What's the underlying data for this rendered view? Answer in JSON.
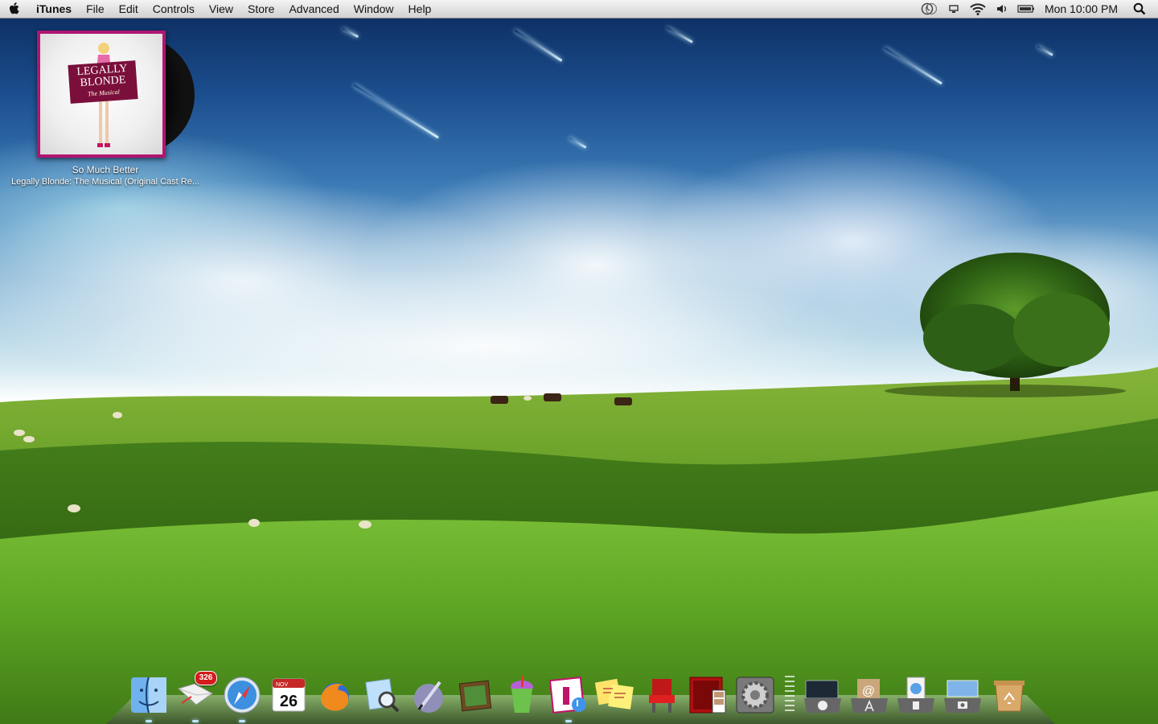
{
  "menubar": {
    "apple_icon": "apple-icon",
    "app_name": "iTunes",
    "menus": [
      "File",
      "Edit",
      "Controls",
      "View",
      "Store",
      "Advanced",
      "Window",
      "Help"
    ],
    "status_icons": [
      "time-machine-icon",
      "display-icon",
      "wifi-icon",
      "volume-icon",
      "battery-icon"
    ],
    "clock": "Mon 10:00 PM",
    "spotlight_icon": "spotlight-search-icon"
  },
  "now_playing": {
    "song": "So Much Better",
    "album": "Legally Blonde: The Musical (Original Cast Re...",
    "art_title_line1": "LEGALLY",
    "art_title_line2": "BLONDE",
    "art_subtitle": "The Musical"
  },
  "dock": {
    "apps": [
      {
        "name": "Finder",
        "icon": "finder-icon",
        "running": true
      },
      {
        "name": "Mail",
        "icon": "mail-icon",
        "badge": "326",
        "running": true
      },
      {
        "name": "Safari",
        "icon": "safari-icon",
        "running": true
      },
      {
        "name": "iCal",
        "icon": "calendar-icon",
        "month": "NOV",
        "day": "26"
      },
      {
        "name": "Firefox",
        "icon": "firefox-icon"
      },
      {
        "name": "Preview",
        "icon": "preview-icon"
      },
      {
        "name": "Script Editor",
        "icon": "script-editor-icon"
      },
      {
        "name": "iPhoto",
        "icon": "photo-frame-icon"
      },
      {
        "name": "Slurpee",
        "icon": "slurpee-cup-icon"
      },
      {
        "name": "iTunes",
        "icon": "itunes-icon",
        "running": true
      },
      {
        "name": "Stickies",
        "icon": "stickies-icon"
      },
      {
        "name": "Front Row",
        "icon": "front-row-chair-icon"
      },
      {
        "name": "Photo Booth",
        "icon": "photo-booth-icon"
      },
      {
        "name": "System Preferences",
        "icon": "system-preferences-icon"
      }
    ],
    "stacks": [
      {
        "name": "Applications",
        "icon": "applications-stack-icon"
      },
      {
        "name": "App Store",
        "icon": "app-store-stack-icon"
      },
      {
        "name": "Documents",
        "icon": "documents-stack-icon"
      },
      {
        "name": "Pictures",
        "icon": "pictures-stack-icon"
      },
      {
        "name": "Trash",
        "icon": "trash-icon"
      }
    ]
  },
  "colors": {
    "sky_top": "#0b2a5c",
    "grass": "#4f8f1c",
    "badge_red": "#d51b1b",
    "album_frame": "#b01572"
  }
}
